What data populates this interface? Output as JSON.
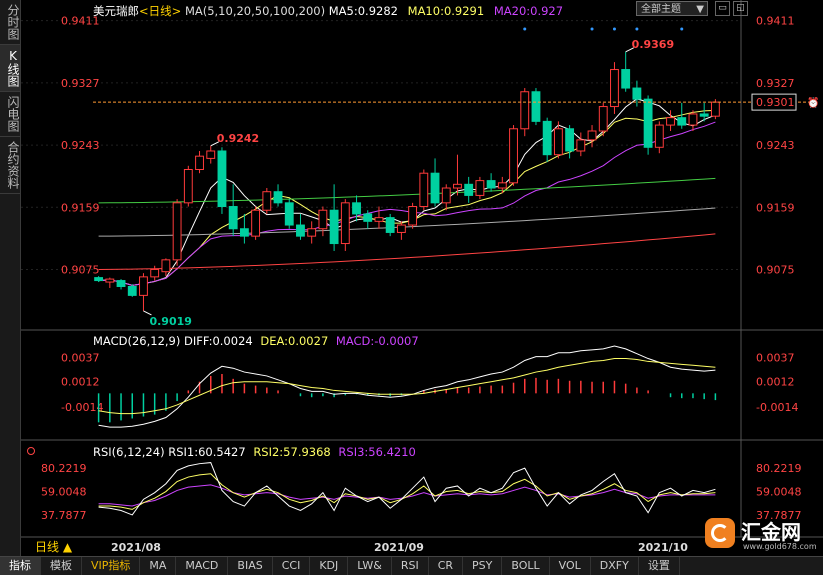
{
  "sidebar": {
    "tabs": [
      "分时图",
      "K线图",
      "闪电图",
      "合约资料"
    ],
    "active_index": 1
  },
  "main": {
    "title": "美元瑞郎",
    "period_tag": "<日线>",
    "ma_label": "MA(5,10,20,50,100,200)",
    "ma5": "MA5:0.9282",
    "ma10": "MA10:0.9291",
    "ma20": "MA20:0.927",
    "theme_select": "全部主题",
    "y_ticks": [
      "0.9411",
      "0.9327",
      "0.9243",
      "0.9159",
      "0.9075"
    ],
    "last_price": "0.9301",
    "high_label": "0.9369",
    "mid_high_label": "0.9242",
    "low_label": "0.9019"
  },
  "macd": {
    "label": "MACD(26,12,9)",
    "diff": "DIFF:0.0024",
    "dea": "DEA:0.0027",
    "macd": "MACD:-0.0007",
    "y_ticks": [
      "0.0037",
      "0.0012",
      "-0.0014"
    ]
  },
  "rsi": {
    "label": "RSI(6,12,24)",
    "rsi1": "RSI1:60.5427",
    "rsi2": "RSI2:57.9368",
    "rsi3": "RSI3:56.4210",
    "y_ticks": [
      "80.2219",
      "59.0048",
      "37.7877"
    ]
  },
  "x_axis": [
    "2021/08",
    "2021/09",
    "2021/10"
  ],
  "period_button": "日线",
  "bottom_tabs": [
    "指标",
    "模板",
    "VIP指标",
    "MA",
    "MACD",
    "BIAS",
    "CCI",
    "KDJ",
    "LW&",
    "RSI",
    "CR",
    "PSY",
    "BOLL",
    "VOL",
    "DXFY",
    "设置"
  ],
  "logo": {
    "name": "汇金网",
    "url": "www.gold678.com"
  },
  "colors": {
    "up": "#ff3b3b",
    "down": "#00d0a0",
    "ma5": "#ffffff",
    "ma10": "#ffff66",
    "ma20": "#cc44ff",
    "ma50": "#44cc44",
    "ma100": "#aaaaaa",
    "ma200": "#ff4444",
    "accent": "#ffd200"
  },
  "chart_data": {
    "type": "candlestick",
    "ylim": [
      0.9,
      0.942
    ],
    "candles": [
      [
        0.9064,
        0.9066,
        0.9058,
        0.906
      ],
      [
        0.9058,
        0.9064,
        0.905,
        0.9062
      ],
      [
        0.906,
        0.9062,
        0.9048,
        0.9052
      ],
      [
        0.9052,
        0.9055,
        0.9038,
        0.904
      ],
      [
        0.904,
        0.907,
        0.9019,
        0.9065
      ],
      [
        0.9065,
        0.908,
        0.906,
        0.9075
      ],
      [
        0.9072,
        0.909,
        0.9066,
        0.9088
      ],
      [
        0.9088,
        0.917,
        0.908,
        0.9165
      ],
      [
        0.9165,
        0.9215,
        0.916,
        0.921
      ],
      [
        0.921,
        0.9235,
        0.9205,
        0.9228
      ],
      [
        0.9225,
        0.9242,
        0.9218,
        0.9235
      ],
      [
        0.9235,
        0.924,
        0.915,
        0.916
      ],
      [
        0.916,
        0.919,
        0.912,
        0.913
      ],
      [
        0.913,
        0.915,
        0.911,
        0.912
      ],
      [
        0.912,
        0.916,
        0.9115,
        0.9155
      ],
      [
        0.9155,
        0.9185,
        0.915,
        0.918
      ],
      [
        0.918,
        0.919,
        0.916,
        0.9165
      ],
      [
        0.9165,
        0.917,
        0.913,
        0.9135
      ],
      [
        0.9135,
        0.915,
        0.9115,
        0.912
      ],
      [
        0.912,
        0.914,
        0.911,
        0.913
      ],
      [
        0.913,
        0.916,
        0.912,
        0.9155
      ],
      [
        0.9155,
        0.919,
        0.91,
        0.911
      ],
      [
        0.911,
        0.917,
        0.91,
        0.9165
      ],
      [
        0.9165,
        0.9175,
        0.914,
        0.915
      ],
      [
        0.915,
        0.9155,
        0.913,
        0.914
      ],
      [
        0.914,
        0.916,
        0.913,
        0.9145
      ],
      [
        0.9145,
        0.915,
        0.912,
        0.9125
      ],
      [
        0.9125,
        0.914,
        0.9115,
        0.9135
      ],
      [
        0.9135,
        0.9165,
        0.913,
        0.916
      ],
      [
        0.916,
        0.921,
        0.9155,
        0.9205
      ],
      [
        0.9205,
        0.9225,
        0.916,
        0.9165
      ],
      [
        0.9165,
        0.919,
        0.9155,
        0.9185
      ],
      [
        0.9185,
        0.923,
        0.9175,
        0.919
      ],
      [
        0.919,
        0.92,
        0.9165,
        0.9175
      ],
      [
        0.9175,
        0.92,
        0.917,
        0.9195
      ],
      [
        0.9195,
        0.9205,
        0.918,
        0.9185
      ],
      [
        0.9185,
        0.92,
        0.9178,
        0.9192
      ],
      [
        0.9192,
        0.927,
        0.9188,
        0.9265
      ],
      [
        0.9265,
        0.932,
        0.9255,
        0.9315
      ],
      [
        0.9315,
        0.932,
        0.927,
        0.9275
      ],
      [
        0.9275,
        0.928,
        0.922,
        0.923
      ],
      [
        0.923,
        0.9275,
        0.9225,
        0.9265
      ],
      [
        0.9265,
        0.927,
        0.9225,
        0.9235
      ],
      [
        0.9235,
        0.926,
        0.9228,
        0.925
      ],
      [
        0.925,
        0.927,
        0.924,
        0.9262
      ],
      [
        0.9262,
        0.93,
        0.9255,
        0.9295
      ],
      [
        0.9295,
        0.9355,
        0.9285,
        0.9345
      ],
      [
        0.9345,
        0.9369,
        0.9315,
        0.932
      ],
      [
        0.932,
        0.933,
        0.9295,
        0.9305
      ],
      [
        0.9305,
        0.931,
        0.923,
        0.924
      ],
      [
        0.924,
        0.9275,
        0.9232,
        0.927
      ],
      [
        0.927,
        0.929,
        0.9262,
        0.928
      ],
      [
        0.928,
        0.93,
        0.9265,
        0.927
      ],
      [
        0.927,
        0.929,
        0.9262,
        0.9285
      ],
      [
        0.9285,
        0.93,
        0.9275,
        0.9282
      ],
      [
        0.9282,
        0.9305,
        0.9278,
        0.9301
      ]
    ],
    "macd_hist": [
      -0.003,
      -0.003,
      -0.0028,
      -0.0026,
      -0.0024,
      -0.0022,
      -0.0018,
      -0.0008,
      0.0003,
      0.0012,
      0.0018,
      0.002,
      0.0015,
      0.001,
      0.0008,
      0.0006,
      0.0003,
      0.0,
      -0.0003,
      -0.0004,
      -0.0003,
      -0.0004,
      -0.0002,
      -0.0001,
      -0.0002,
      -0.0002,
      -0.0003,
      -0.0002,
      0.0,
      0.0003,
      0.0004,
      0.0004,
      0.0006,
      0.0006,
      0.0007,
      0.0008,
      0.0008,
      0.0011,
      0.0015,
      0.0016,
      0.0014,
      0.0015,
      0.0013,
      0.0013,
      0.0012,
      0.0012,
      0.0013,
      0.001,
      0.0006,
      0.0003,
      0.0,
      -0.0004,
      -0.0005,
      -0.0005,
      -0.0006,
      -0.0007
    ],
    "dea": [
      -0.0018,
      -0.002,
      -0.0021,
      -0.0021,
      -0.002,
      -0.0018,
      -0.0016,
      -0.0012,
      -0.0007,
      -0.0002,
      0.0003,
      0.0008,
      0.0011,
      0.0012,
      0.0012,
      0.0012,
      0.0011,
      0.001,
      0.0008,
      0.0006,
      0.0005,
      0.0003,
      0.0002,
      0.0001,
      0.0,
      -0.0001,
      -0.0001,
      -0.0001,
      -0.0001,
      0.0,
      0.0002,
      0.0004,
      0.0006,
      0.0008,
      0.001,
      0.0012,
      0.0014,
      0.0016,
      0.0019,
      0.0022,
      0.0024,
      0.0027,
      0.0029,
      0.0031,
      0.0033,
      0.0034,
      0.0036,
      0.0036,
      0.0035,
      0.0033,
      0.0032,
      0.0031,
      0.003,
      0.0029,
      0.0028,
      0.0027
    ],
    "diff": [
      -0.0033,
      -0.0035,
      -0.0035,
      -0.0034,
      -0.0032,
      -0.0029,
      -0.0025,
      -0.0016,
      -0.0004,
      0.001,
      0.0021,
      0.0028,
      0.0026,
      0.0022,
      0.002,
      0.0018,
      0.0014,
      0.001,
      0.0005,
      0.0002,
      0.0002,
      -0.0001,
      0.0,
      0.0,
      -0.0002,
      -0.0003,
      -0.0004,
      -0.0003,
      -0.0001,
      0.0003,
      0.0006,
      0.0008,
      0.0012,
      0.0014,
      0.0017,
      0.002,
      0.0022,
      0.0027,
      0.0034,
      0.0038,
      0.0038,
      0.0042,
      0.0042,
      0.0044,
      0.0045,
      0.0046,
      0.0049,
      0.0046,
      0.0041,
      0.0036,
      0.0032,
      0.0027,
      0.0025,
      0.0024,
      0.0023,
      0.0024
    ],
    "rsi1": [
      45,
      44,
      42,
      38,
      52,
      58,
      66,
      78,
      82,
      84,
      85,
      60,
      50,
      46,
      58,
      64,
      55,
      46,
      42,
      48,
      58,
      42,
      62,
      55,
      50,
      54,
      44,
      52,
      62,
      72,
      50,
      62,
      64,
      55,
      62,
      58,
      62,
      76,
      80,
      62,
      46,
      58,
      48,
      56,
      60,
      68,
      75,
      58,
      55,
      40,
      58,
      62,
      55,
      60,
      58,
      61
    ],
    "rsi2": [
      46,
      46,
      45,
      43,
      49,
      53,
      59,
      68,
      72,
      74,
      75,
      65,
      58,
      54,
      58,
      61,
      58,
      52,
      49,
      51,
      55,
      49,
      57,
      55,
      52,
      54,
      49,
      52,
      57,
      64,
      55,
      59,
      60,
      57,
      59,
      58,
      59,
      66,
      70,
      64,
      55,
      58,
      52,
      55,
      57,
      61,
      66,
      60,
      58,
      50,
      56,
      58,
      56,
      57,
      57,
      58
    ],
    "rsi3": [
      48,
      48,
      47,
      46,
      49,
      51,
      55,
      60,
      63,
      64,
      65,
      62,
      58,
      56,
      57,
      58,
      57,
      54,
      52,
      53,
      54,
      52,
      55,
      54,
      53,
      54,
      52,
      53,
      55,
      58,
      55,
      56,
      57,
      56,
      57,
      56,
      57,
      60,
      63,
      60,
      56,
      57,
      54,
      55,
      56,
      58,
      61,
      58,
      57,
      53,
      55,
      56,
      56,
      56,
      56,
      56
    ]
  }
}
